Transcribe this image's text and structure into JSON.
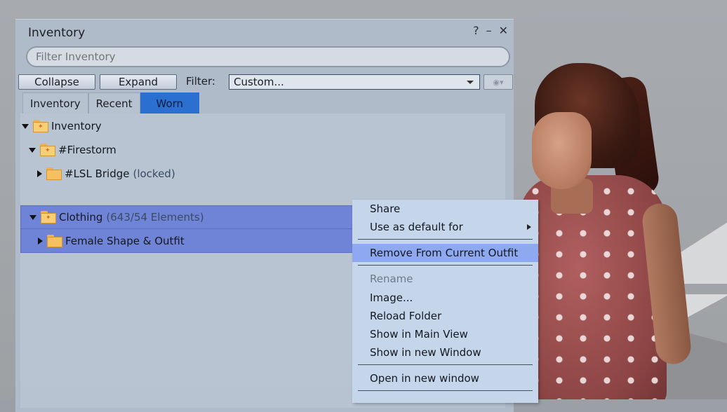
{
  "window": {
    "title": "Inventory",
    "help_icon": "?",
    "minimize_icon": "–",
    "close_icon": "✕"
  },
  "filter": {
    "placeholder": "Filter Inventory",
    "collapse_label": "Collapse",
    "expand_label": "Expand",
    "filter_label": "Filter:",
    "filter_value": "Custom..."
  },
  "tabs": [
    {
      "label": "Inventory"
    },
    {
      "label": "Recent"
    },
    {
      "label": "Worn",
      "active": true
    }
  ],
  "tree": {
    "root": {
      "label": "Inventory"
    },
    "firestorm": {
      "label": "#Firestorm"
    },
    "lsl_bridge": {
      "label": "#LSL Bridge",
      "note": "(locked)"
    },
    "clothing": {
      "label": "Clothing",
      "note": "(643/54 Elements)"
    },
    "female_shape": {
      "label": "Female Shape & Outfit"
    }
  },
  "context_menu": {
    "items": [
      {
        "label": "Share"
      },
      {
        "label": "Use as default for",
        "submenu": true
      },
      {
        "label": "Remove From Current Outfit",
        "highlighted": true
      },
      {
        "label": "Rename",
        "disabled": true
      },
      {
        "label": "Image..."
      },
      {
        "label": "Reload Folder"
      },
      {
        "label": "Show in Main View"
      },
      {
        "label": "Show in new Window"
      },
      {
        "label": "Open in new window"
      }
    ]
  },
  "colors": {
    "selection": "#6f84d6",
    "menu_highlight": "#8fa9f0",
    "active_tab": "#2b6fd0"
  }
}
